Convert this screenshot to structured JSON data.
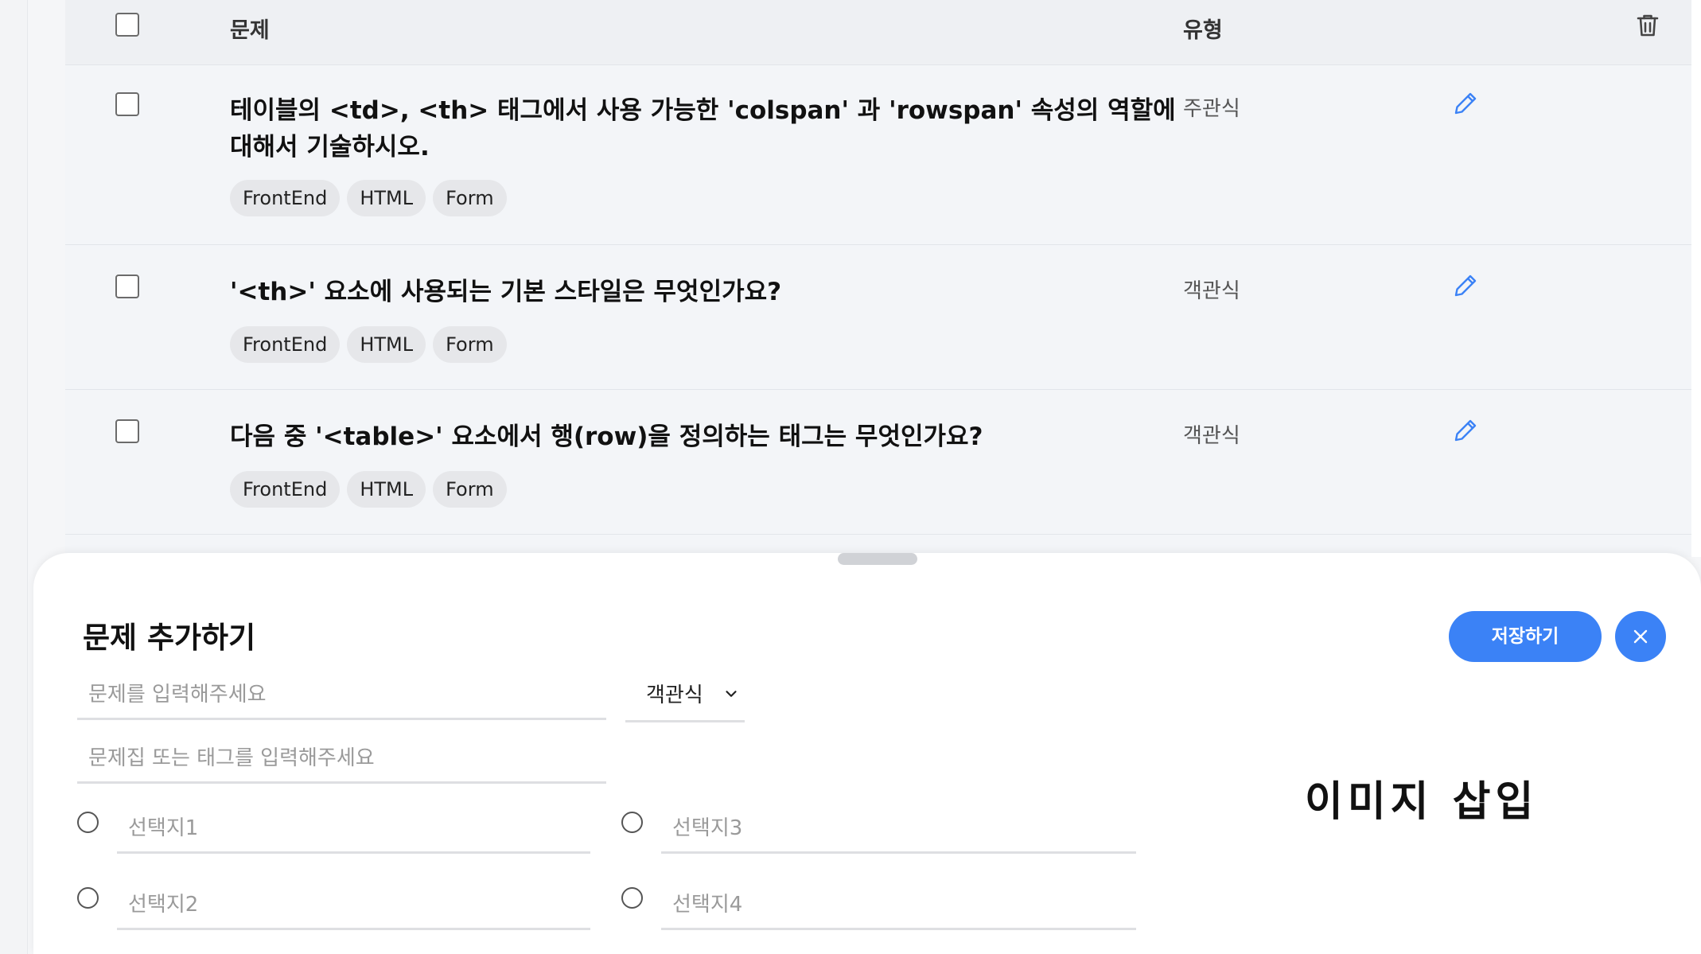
{
  "table": {
    "headers": {
      "question": "문제",
      "type": "유형"
    },
    "rows": [
      {
        "title": "테이블의 <td>, <th> 태그에서 사용 가능한 'colspan' 과 'rowspan' 속성의 역할에 대해서 기술하시오.",
        "type": "주관식",
        "tags": [
          "FrontEnd",
          "HTML",
          "Form"
        ]
      },
      {
        "title": "'<th>' 요소에 사용되는 기본 스타일은 무엇인가요?",
        "type": "객관식",
        "tags": [
          "FrontEnd",
          "HTML",
          "Form"
        ]
      },
      {
        "title": "다음 중 '<table>' 요소에서 행(row)을 정의하는 태그는 무엇인가요?",
        "type": "객관식",
        "tags": [
          "FrontEnd",
          "HTML",
          "Form"
        ]
      }
    ]
  },
  "sheet": {
    "title": "문제 추가하기",
    "save_label": "저장하기",
    "question_placeholder": "문제를 입력해주세요",
    "type_select": "객관식",
    "tag_placeholder": "문제집 또는 태그를 입력해주세요",
    "choices": [
      "선택지1",
      "선택지2",
      "선택지3",
      "선택지4"
    ],
    "image_insert_label": "이미지 삽입"
  },
  "colors": {
    "accent": "#3b82f6",
    "edit_icon": "#3b82f6"
  },
  "icons": [
    "trash-icon",
    "edit-icon",
    "close-icon",
    "chevron-down-icon"
  ]
}
